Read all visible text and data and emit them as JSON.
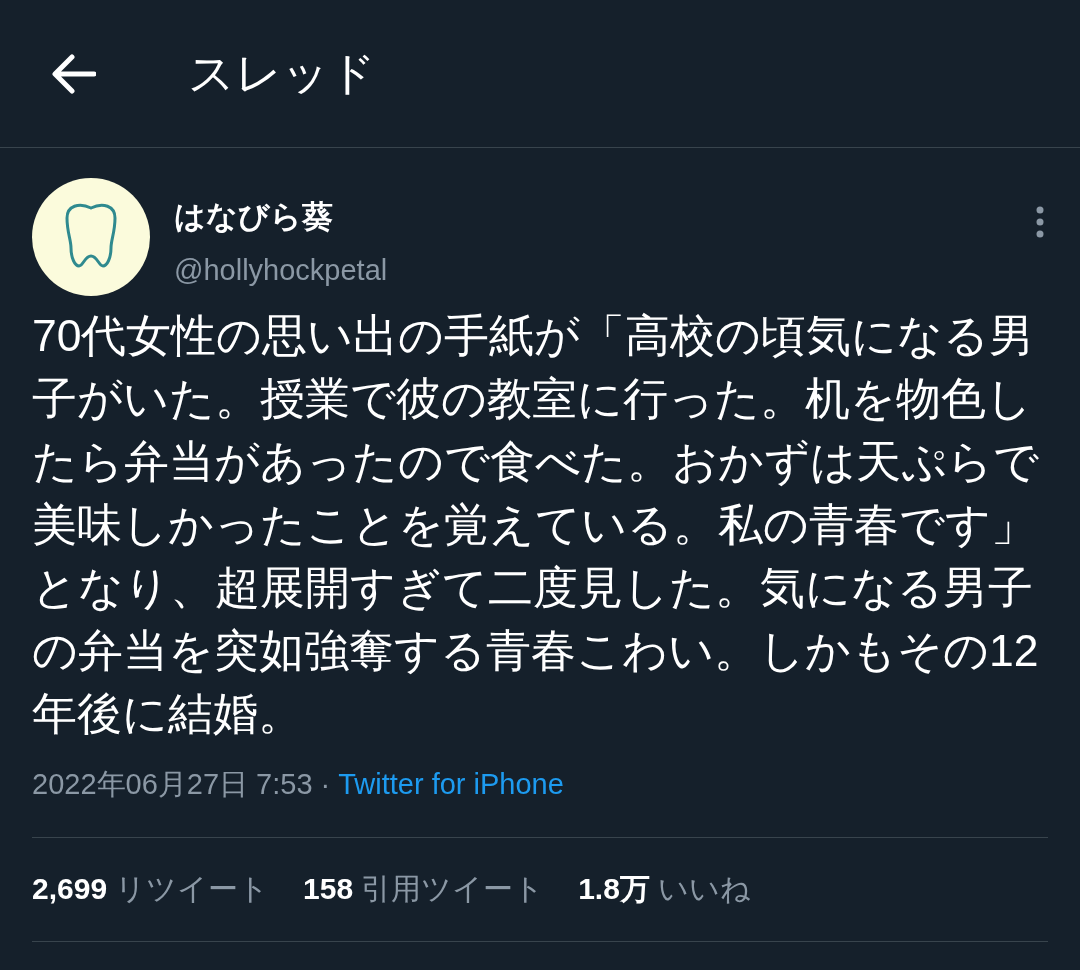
{
  "header": {
    "title": "スレッド"
  },
  "tweet": {
    "author": {
      "name": "はなびら葵",
      "handle": "@hollyhockpetal"
    },
    "text": "70代女性の思い出の手紙が「高校の頃気になる男子がいた。授業で彼の教室に行った。机を物色したら弁当があったので食べた。おかずは天ぷらで美味しかったことを覚えている。私の青春です」となり、超展開すぎて二度見した。気になる男子の弁当を突如強奪する青春こわい。しかもその12年後に結婚。",
    "timestamp": "2022年06月27日 7:53",
    "separator": "·",
    "source": "Twitter for iPhone",
    "stats": [
      {
        "count": "2,699",
        "label": "リツイート"
      },
      {
        "count": "158",
        "label": "引用ツイート"
      },
      {
        "count": "1.8万",
        "label": "いいね"
      }
    ]
  }
}
